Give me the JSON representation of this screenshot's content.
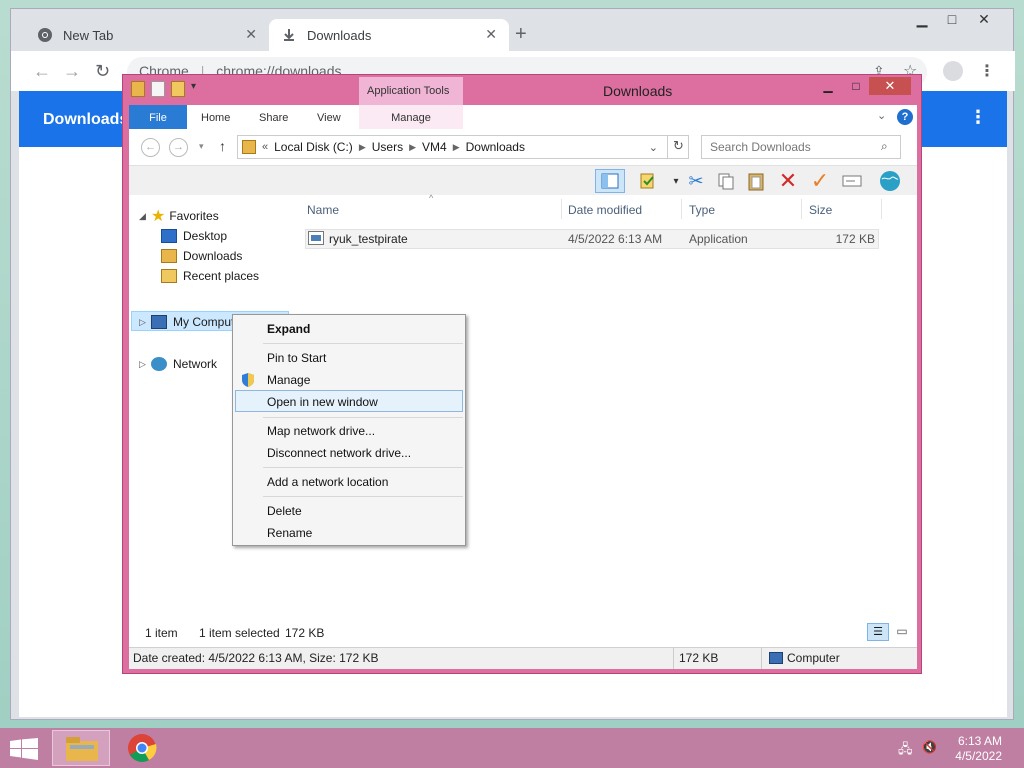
{
  "browser": {
    "tabs": [
      {
        "label": "New Tab",
        "icon": "chrome-icon"
      },
      {
        "label": "Downloads",
        "icon": "download-icon"
      }
    ],
    "url_scheme": "Chrome",
    "url": "chrome://downloads",
    "page_title": "Downloads",
    "accent": "#1a73e8"
  },
  "explorer": {
    "title": "Downloads",
    "application_tools": "Application Tools",
    "ribbon_tabs": [
      "File",
      "Home",
      "Share",
      "View",
      "Manage"
    ],
    "breadcrumb": [
      "Local Disk (C:)",
      "Users",
      "VM4",
      "Downloads"
    ],
    "breadcrumb_prefix": "«",
    "search_placeholder": "Search Downloads",
    "nav": {
      "favorites": "Favorites",
      "desktop": "Desktop",
      "downloads": "Downloads",
      "recent": "Recent places",
      "computer": "My Computer",
      "network": "Network"
    },
    "columns": [
      "Name",
      "Date modified",
      "Type",
      "Size"
    ],
    "files": [
      {
        "name": "ryuk_testpirate",
        "date": "4/5/2022 6:13 AM",
        "type": "Application",
        "size": "172 KB"
      }
    ],
    "status": {
      "count": "1 item",
      "selected": "1 item selected",
      "size": "172 KB"
    },
    "bottom": {
      "details": "Date created: 4/5/2022 6:13 AM, Size: 172 KB",
      "size": "172 KB",
      "location": "Computer"
    },
    "frame_color": "#dd6fa0"
  },
  "context_menu": {
    "items": [
      {
        "label": "Expand",
        "bold": true
      },
      {
        "label": "Pin to Start"
      },
      {
        "label": "Manage",
        "icon": "shield-icon"
      },
      {
        "label": "Open in new window",
        "highlighted": true
      },
      {
        "label": "Map network drive..."
      },
      {
        "label": "Disconnect network drive..."
      },
      {
        "label": "Add a network location"
      },
      {
        "label": "Delete"
      },
      {
        "label": "Rename"
      }
    ]
  },
  "taskbar": {
    "time": "6:13 AM",
    "date": "4/5/2022",
    "color": "#bf7fa3"
  }
}
